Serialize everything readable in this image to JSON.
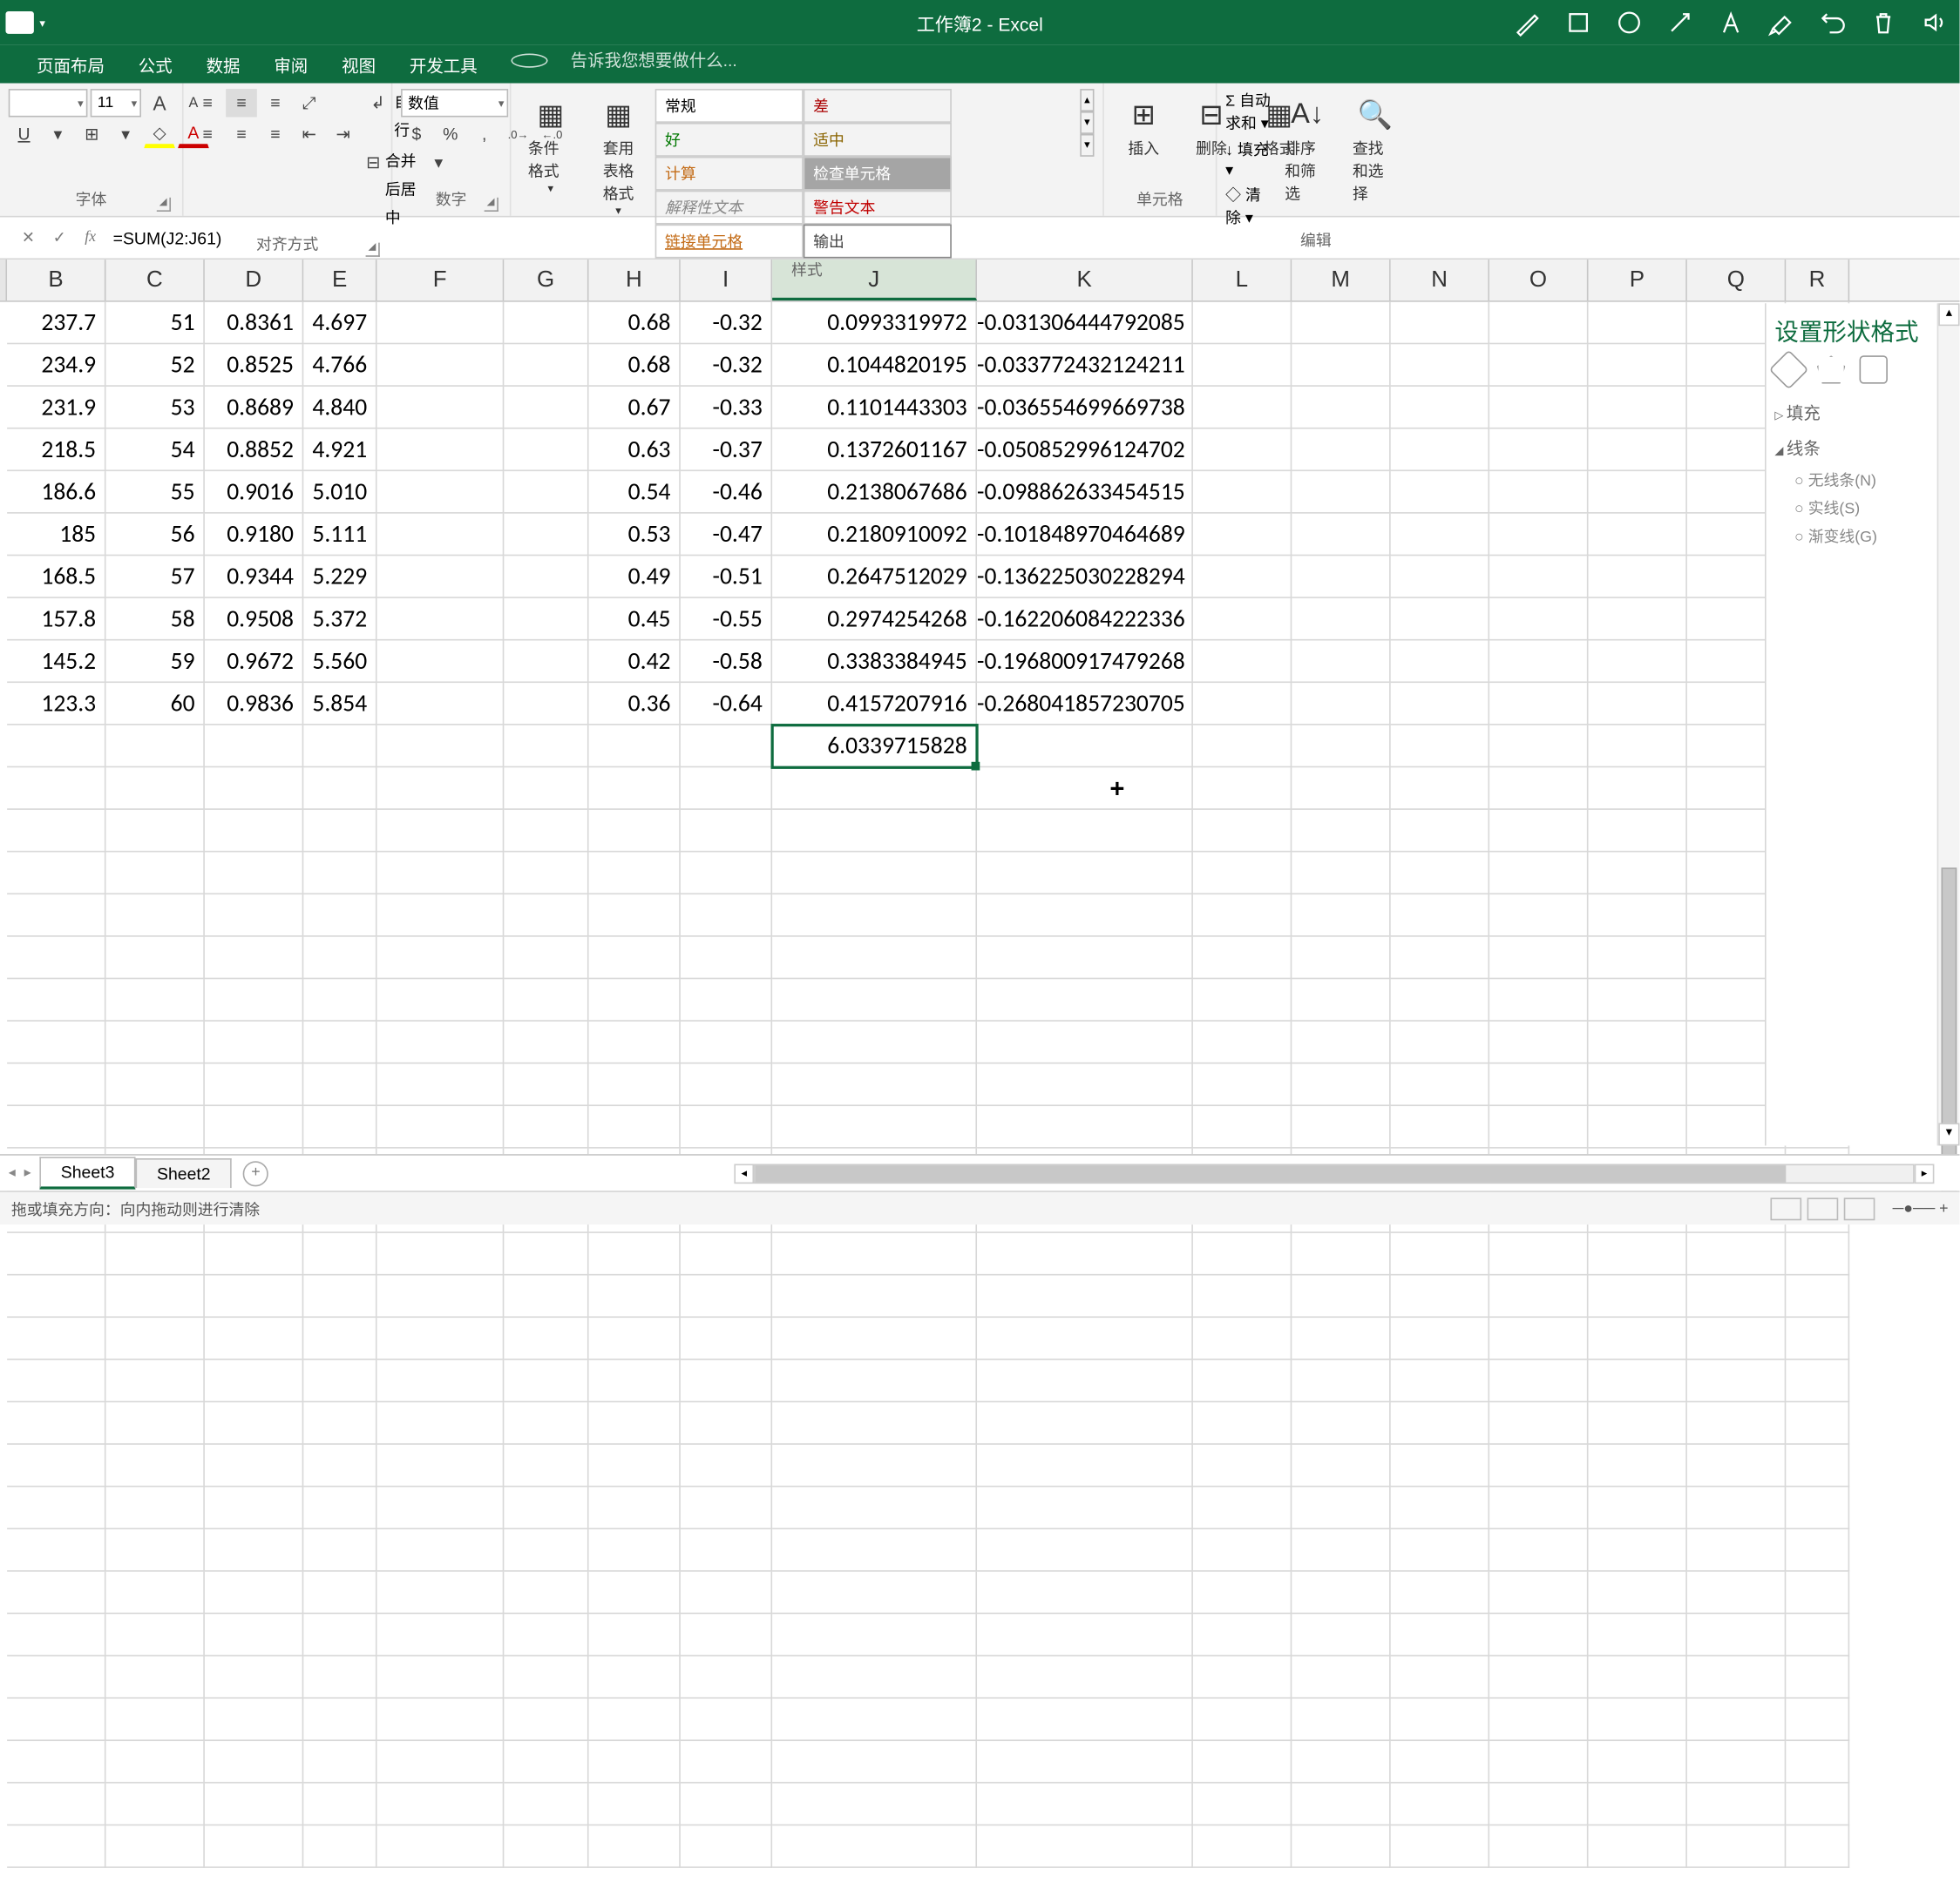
{
  "title": "工作簿2 - Excel",
  "tabs": {
    "layout": "页面布局",
    "formulas": "公式",
    "data": "数据",
    "review": "审阅",
    "view": "视图",
    "dev": "开发工具",
    "tellme": "告诉我您想要做什么..."
  },
  "ribbon": {
    "font": {
      "size": "11",
      "grow": "A",
      "shrink": "A",
      "underline": "U",
      "label": "字体"
    },
    "align": {
      "wrap": "自动换行",
      "merge": "合并后居中",
      "label": "对齐方式"
    },
    "number": {
      "category": "数值",
      "percent": "%",
      "comma": ",",
      "dec_inc": ".0→.00",
      "dec_dec": ".00→.0",
      "label": "数字"
    },
    "styles": {
      "cond": "条件格式",
      "table": "套用\n表格格式",
      "s1": "常规",
      "s2": "差",
      "s3": "好",
      "s4": "适中",
      "s5": "计算",
      "s6": "检查单元格",
      "s7": "解释性文本",
      "s8": "警告文本",
      "s9": "链接单元格",
      "s10": "输出",
      "label": "样式"
    },
    "cells": {
      "insert": "插入",
      "delete": "删除",
      "format": "格式",
      "label": "单元格"
    },
    "edit": {
      "sum": "自动求和",
      "fill": "填充",
      "clear": "清除",
      "sort": "排序和筛选",
      "find": "查找和选择",
      "label": "编辑"
    }
  },
  "namebox": "",
  "formula": "=SUM(J2:J61)",
  "columns": [
    "B",
    "C",
    "D",
    "E",
    "F",
    "G",
    "H",
    "I",
    "J",
    "K",
    "L",
    "M",
    "N",
    "O",
    "P",
    "Q",
    "R"
  ],
  "rows": [
    {
      "B": "237.7",
      "C": "51",
      "D": "0.8361",
      "E": "4.697",
      "H": "0.68",
      "I": "-0.32",
      "J": "0.0993319972",
      "K": "-0.031306444792085"
    },
    {
      "B": "234.9",
      "C": "52",
      "D": "0.8525",
      "E": "4.766",
      "H": "0.68",
      "I": "-0.32",
      "J": "0.1044820195",
      "K": "-0.033772432124211"
    },
    {
      "B": "231.9",
      "C": "53",
      "D": "0.8689",
      "E": "4.840",
      "H": "0.67",
      "I": "-0.33",
      "J": "0.1101443303",
      "K": "-0.036554699669738"
    },
    {
      "B": "218.5",
      "C": "54",
      "D": "0.8852",
      "E": "4.921",
      "H": "0.63",
      "I": "-0.37",
      "J": "0.1372601167",
      "K": "-0.050852996124702"
    },
    {
      "B": "186.6",
      "C": "55",
      "D": "0.9016",
      "E": "5.010",
      "H": "0.54",
      "I": "-0.46",
      "J": "0.2138067686",
      "K": "-0.098862633454515"
    },
    {
      "B": "185",
      "C": "56",
      "D": "0.9180",
      "E": "5.111",
      "H": "0.53",
      "I": "-0.47",
      "J": "0.2180910092",
      "K": "-0.101848970464689"
    },
    {
      "B": "168.5",
      "C": "57",
      "D": "0.9344",
      "E": "5.229",
      "H": "0.49",
      "I": "-0.51",
      "J": "0.2647512029",
      "K": "-0.136225030228294"
    },
    {
      "B": "157.8",
      "C": "58",
      "D": "0.9508",
      "E": "5.372",
      "H": "0.45",
      "I": "-0.55",
      "J": "0.2974254268",
      "K": "-0.162206084222336"
    },
    {
      "B": "145.2",
      "C": "59",
      "D": "0.9672",
      "E": "5.560",
      "H": "0.42",
      "I": "-0.58",
      "J": "0.3383384945",
      "K": "-0.196800917479268"
    },
    {
      "B": "123.3",
      "C": "60",
      "D": "0.9836",
      "E": "5.854",
      "H": "0.36",
      "I": "-0.64",
      "J": "0.4157207916",
      "K": "-0.268041857230705"
    }
  ],
  "sum_cell": "6.0339715828",
  "taskpane": {
    "title": "设置形状格式",
    "fill": "填充",
    "line": "线条",
    "opt1": "无线条(N)",
    "opt2": "实线(S)",
    "opt3": "渐变线(G)"
  },
  "sheets": {
    "s1": "Sheet3",
    "s2": "Sheet2"
  },
  "status": {
    "mode": "拖或填充方向：向内拖动则进行清除"
  }
}
